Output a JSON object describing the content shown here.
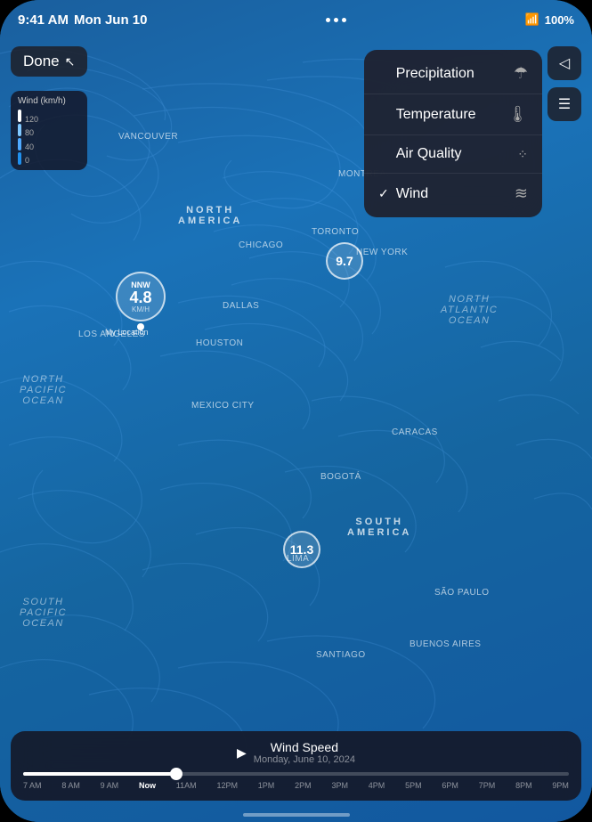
{
  "statusBar": {
    "time": "9:41 AM",
    "day": "Mon Jun 10",
    "wifi": "100%",
    "battery": "100%"
  },
  "doneButton": {
    "label": "Done"
  },
  "windLegend": {
    "title": "Wind (km/h)",
    "labels": [
      "120",
      "80",
      "40",
      "0"
    ]
  },
  "layerMenu": {
    "items": [
      {
        "id": "precipitation",
        "label": "Precipitation",
        "icon": "🌂",
        "checked": false
      },
      {
        "id": "temperature",
        "label": "Temperature",
        "icon": "🌡",
        "checked": false
      },
      {
        "id": "air-quality",
        "label": "Air Quality",
        "icon": "💨",
        "checked": false
      },
      {
        "id": "wind",
        "label": "Wind",
        "icon": "🌬",
        "checked": true
      }
    ]
  },
  "mapLabels": {
    "continents": [
      {
        "id": "north-america",
        "label": "NORTH\nAMERICA"
      },
      {
        "id": "south-america",
        "label": "SOUTH\nAMERICA"
      }
    ],
    "oceans": [
      {
        "id": "north-pacific",
        "label": "North\nPacific\nOcean"
      },
      {
        "id": "north-atlantic",
        "label": "North\nAtlantic\nOcean"
      },
      {
        "id": "south-pacific",
        "label": "South\nPacific\nOcean"
      }
    ],
    "cities": [
      {
        "id": "vancouver",
        "label": "Vancouver"
      },
      {
        "id": "los-angeles",
        "label": "Los Angeles"
      },
      {
        "id": "chicago",
        "label": "Chicago"
      },
      {
        "id": "montreal",
        "label": "Montréal"
      },
      {
        "id": "toronto",
        "label": "Toronto"
      },
      {
        "id": "new-york",
        "label": "New York"
      },
      {
        "id": "dallas",
        "label": "Dallas"
      },
      {
        "id": "houston",
        "label": "Houston"
      },
      {
        "id": "mexico-city",
        "label": "Mexico City"
      },
      {
        "id": "caracas",
        "label": "Caracas"
      },
      {
        "id": "bogota",
        "label": "Bogotá"
      },
      {
        "id": "lima",
        "label": "Lima"
      },
      {
        "id": "santiago",
        "label": "Santiago"
      },
      {
        "id": "buenos-aires",
        "label": "Buenos Aires"
      },
      {
        "id": "sao-paulo",
        "label": "São Paulo"
      }
    ]
  },
  "windPins": [
    {
      "id": "my-location",
      "direction": "NNW",
      "speed": "4.8",
      "unit": "KM/H",
      "location": "My Location"
    },
    {
      "id": "east-pin",
      "speed": "9.7"
    }
  ],
  "timeline": {
    "playLabel": "▶",
    "title": "Wind Speed",
    "subtitle": "Monday, June 10, 2024",
    "labels": [
      "7 AM",
      "8 AM",
      "9 AM",
      "Now",
      "11AM",
      "12PM",
      "1PM",
      "2PM",
      "3PM",
      "4PM",
      "5PM",
      "6PM",
      "7PM",
      "8PM",
      "9PM"
    ]
  }
}
